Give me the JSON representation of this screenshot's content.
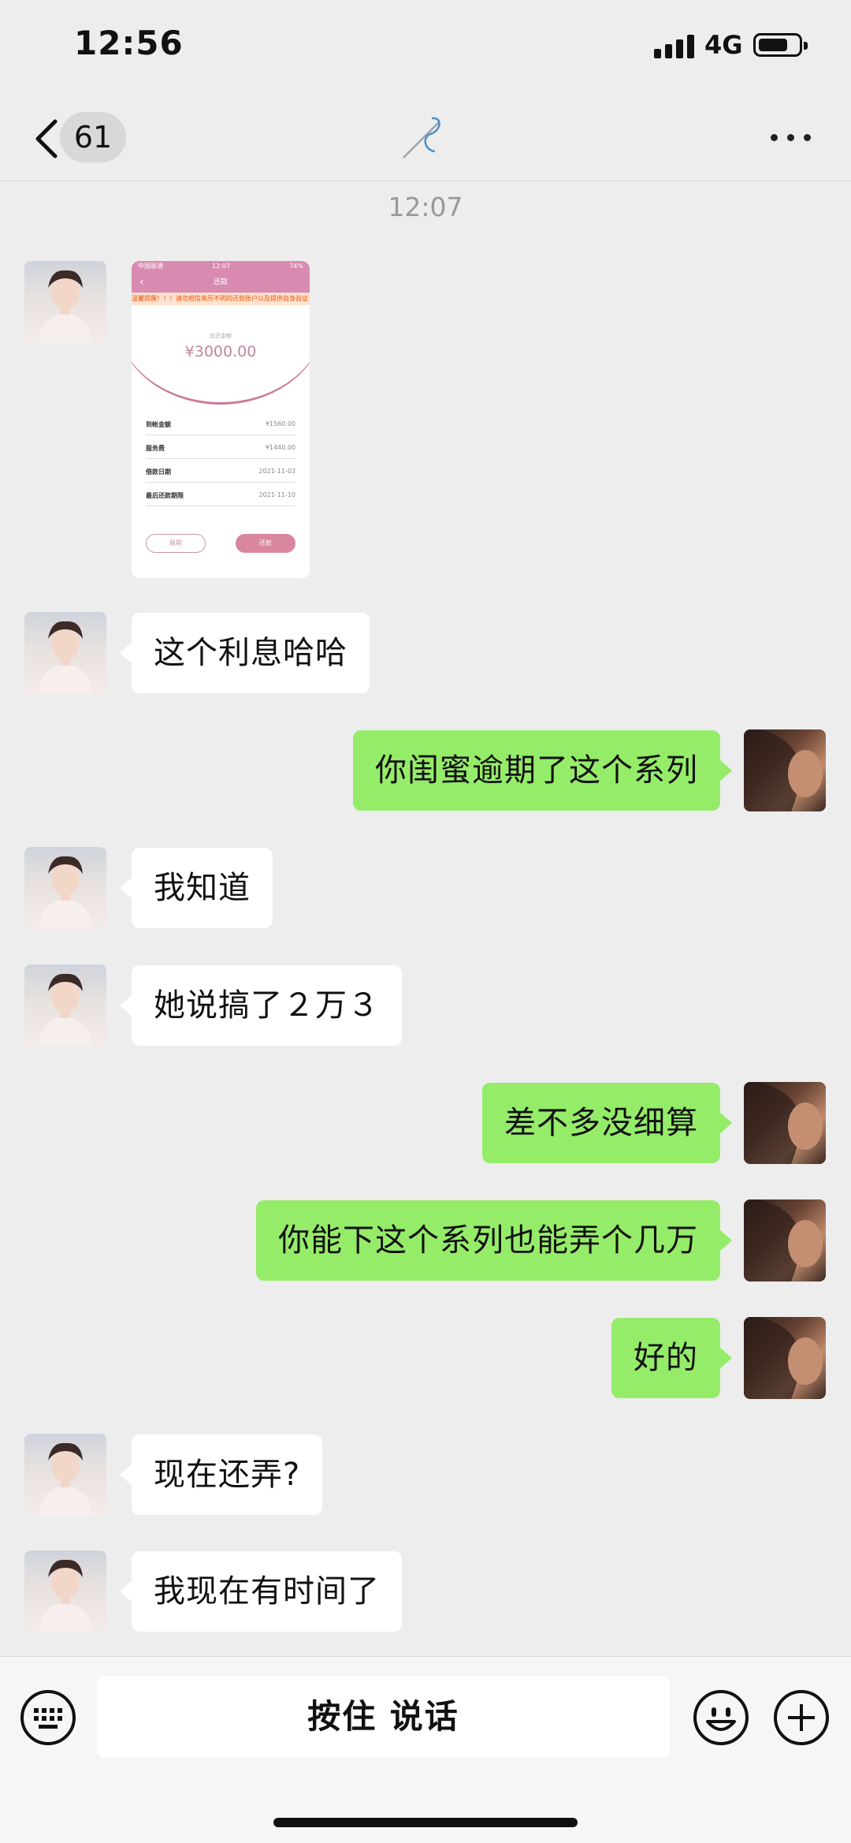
{
  "status_bar": {
    "time": "12:56",
    "network": "4G"
  },
  "nav": {
    "unread_count": "61",
    "title_icon": "needle-thread-icon"
  },
  "timestamp": "12:07",
  "image_message": {
    "status_bar_text": "中国联通",
    "status_time": "12:07",
    "status_battery": "74%",
    "header_title": "还款",
    "notice": "温馨提醒！！！请勿相信来历不明的还款账户以及提供自身验证",
    "amount_label": "应还金额",
    "amount": "¥3000.00",
    "rows": [
      {
        "label": "到帐金额",
        "value": "¥1560.00"
      },
      {
        "label": "服务费",
        "value": "¥1440.00"
      },
      {
        "label": "借款日期",
        "value": "2021-11-03"
      },
      {
        "label": "最后还款期限",
        "value": "2021-11-10"
      }
    ],
    "btn_left": "展期",
    "btn_right": "还款"
  },
  "messages": [
    {
      "side": "in",
      "text": "这个利息哈哈"
    },
    {
      "side": "out",
      "text": "你闺蜜逾期了这个系列"
    },
    {
      "side": "in",
      "text": "我知道"
    },
    {
      "side": "in",
      "text": "她说搞了２万３"
    },
    {
      "side": "out",
      "text": "差不多没细算"
    },
    {
      "side": "out",
      "text": "你能下这个系列也能弄个几万"
    },
    {
      "side": "out",
      "text": "好的"
    },
    {
      "side": "in",
      "text": "现在还弄?"
    },
    {
      "side": "in",
      "text": "我现在有时间了"
    }
  ],
  "input_bar": {
    "talk_label": "按住 说话"
  },
  "colors": {
    "outgoing_bubble": "#95ec69",
    "incoming_bubble": "#ffffff",
    "background": "#ededed"
  }
}
